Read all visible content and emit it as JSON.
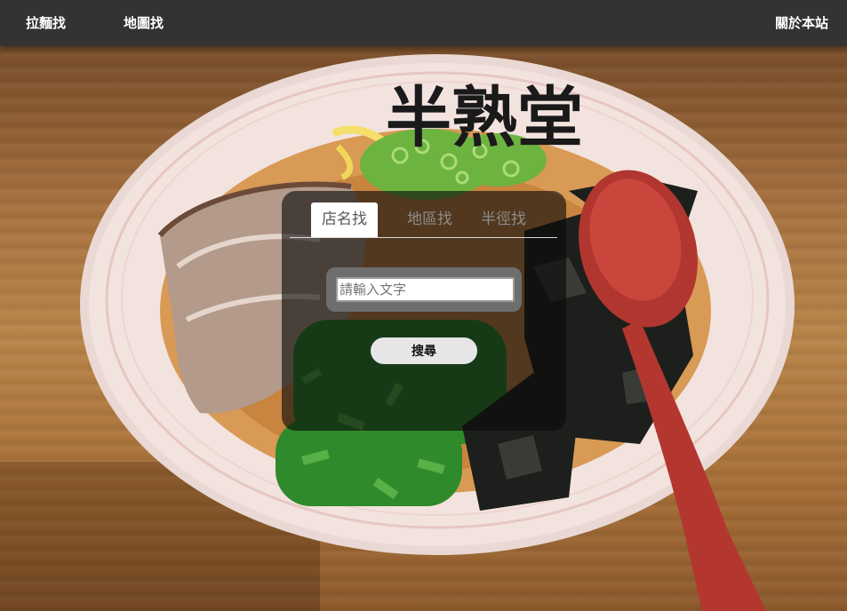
{
  "nav": {
    "ramen_label": "拉麵找",
    "map_label": "地圖找",
    "about_label": "關於本站"
  },
  "search_panel": {
    "tabs": [
      {
        "label": "店名找",
        "active": true
      },
      {
        "label": "地區找",
        "active": false
      },
      {
        "label": "半徑找",
        "active": false
      }
    ],
    "input_placeholder": "請輸入文字",
    "input_value": "",
    "submit_label": "搜尋"
  },
  "background": {
    "bowl_logo_text": "半熟堂"
  },
  "colors": {
    "navbar": "#333333",
    "nav_text": "#ffffff",
    "panel_overlay": "rgba(10,10,10,0.62)",
    "button_bg": "#e6e6e6",
    "active_tab_bg": "#ffffff"
  }
}
